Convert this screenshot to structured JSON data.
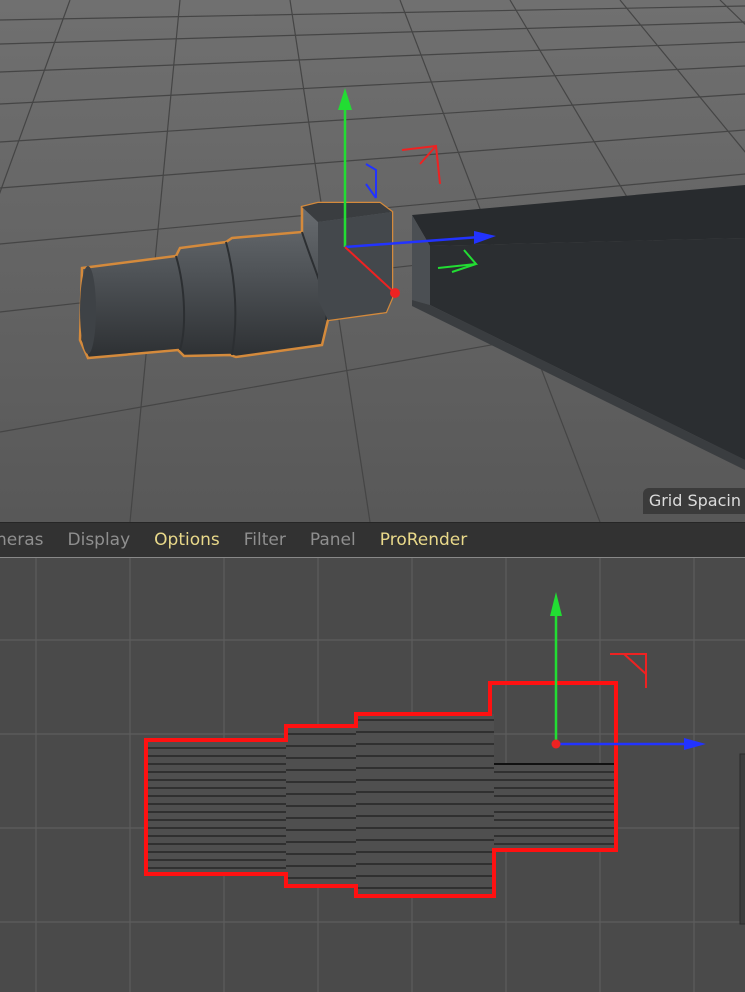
{
  "menu": {
    "items": [
      {
        "label": "neras",
        "highlight": false
      },
      {
        "label": "Display",
        "highlight": false
      },
      {
        "label": "Options",
        "highlight": true
      },
      {
        "label": "Filter",
        "highlight": false
      },
      {
        "label": "Panel",
        "highlight": false
      },
      {
        "label": "ProRender",
        "highlight": true
      }
    ]
  },
  "viewport_top": {
    "hud_label": "Grid Spacin"
  },
  "colors": {
    "axis_x": "#2233ff",
    "axis_y": "#22dd33",
    "axis_z": "#ee2222",
    "selection": "#ff1111",
    "highlight": "#e9d98a"
  }
}
